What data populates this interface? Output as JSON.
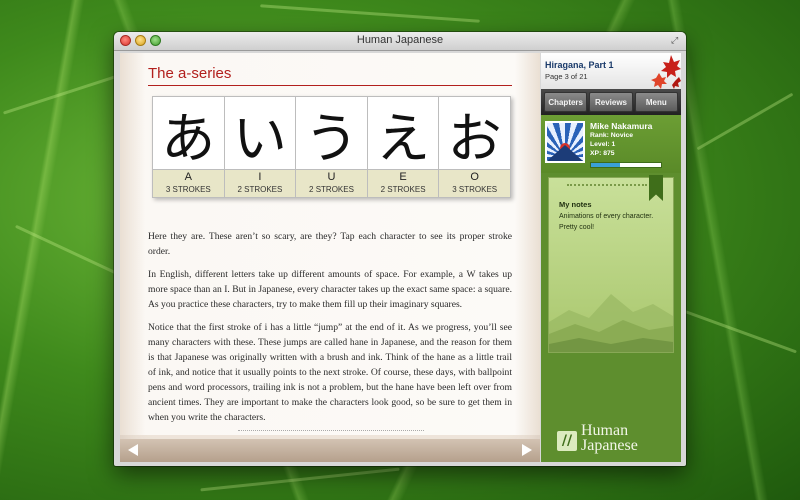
{
  "window": {
    "title": "Human Japanese"
  },
  "lesson": {
    "section_title": "The a-series",
    "kana": [
      {
        "char": "あ",
        "romaji": "A",
        "strokes": "3 STROKES"
      },
      {
        "char": "い",
        "romaji": "I",
        "strokes": "2 STROKES"
      },
      {
        "char": "う",
        "romaji": "U",
        "strokes": "2 STROKES"
      },
      {
        "char": "え",
        "romaji": "E",
        "strokes": "2 STROKES"
      },
      {
        "char": "お",
        "romaji": "O",
        "strokes": "3 STROKES"
      }
    ],
    "paragraphs": [
      "Here they are. These aren’t so scary, are they? Tap each character to see its proper stroke order.",
      "In English, different letters take up different amounts of space. For example, a W takes up more space than an I. But in Japanese, every character takes up the exact same space: a square. As you practice these characters, try to make them fill up their imaginary squares.",
      "Notice that the first stroke of i has a little “jump” at the end of it. As we progress, you’ll see many characters with these. These jumps are called hane in Japanese, and the reason for them is that Japanese was originally written with a brush and ink. Think of the hane as a little trail of ink, and notice that it usually points to the next stroke. Of course, these days, with ballpoint pens and word processors, trailing ink is not a problem, but the hane have been left over from ancient times. They are important to make the characters look good, so be sure to get them in when you write the characters."
    ]
  },
  "sidebar": {
    "chapter_name": "Hiragana, Part 1",
    "chapter_page": "Page 3 of 21",
    "tabs": [
      "Chapters",
      "Reviews",
      "Menu"
    ],
    "profile": {
      "name": "Mike Nakamura",
      "rank": "Rank: Novice",
      "level": "Level: 1",
      "xp": "XP: 875",
      "xp_progress": 0.42
    },
    "notes": {
      "title": "My notes",
      "body": "Animations of every character. Pretty cool!"
    },
    "brand": {
      "line1": "Human",
      "line2": "Japanese"
    }
  },
  "icons": [
    "close-icon",
    "minimize-icon",
    "zoom-icon",
    "fullscreen-icon",
    "left-arrow-icon",
    "right-arrow-icon",
    "maple-leaf-icon",
    "bookmark-ribbon-icon",
    "logo-icon"
  ],
  "colors": {
    "accent_red": "#b2201d",
    "sidebar_green": "#5e8e2e",
    "xp_blue": "#3aa0d8"
  }
}
